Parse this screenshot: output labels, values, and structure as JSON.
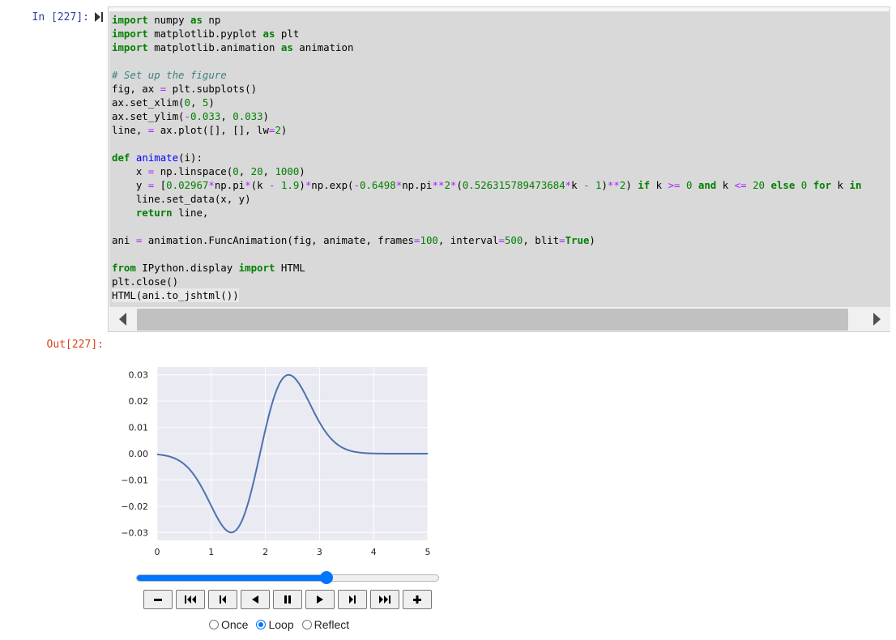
{
  "cell": {
    "in_prompt": "In [227]:",
    "out_prompt": "Out[227]:",
    "code_lines": [
      "import numpy as np",
      "import matplotlib.pyplot as plt",
      "import matplotlib.animation as animation",
      "",
      "# Set up the figure",
      "fig, ax = plt.subplots()",
      "ax.set_xlim(0, 5)",
      "ax.set_ylim(-0.033, 0.033)",
      "line, = ax.plot([], [], lw=2)",
      "",
      "def animate(i):",
      "    x = np.linspace(0, 20, 1000)",
      "    y = [0.02967*np.pi*(k - 1.9)*np.exp(-0.6498*np.pi**2*(0.526315789473684*k - 1)**2) if k >= 0 and k <= 20 else 0 for k in",
      "    line.set_data(x, y)",
      "    return line,",
      "",
      "ani = animation.FuncAnimation(fig, animate, frames=100, interval=500, blit=True)",
      "",
      "from IPython.display import HTML",
      "plt.close()",
      "HTML(ani.to_jshtml())"
    ]
  },
  "chart_data": {
    "type": "line",
    "xlim": [
      0,
      5
    ],
    "ylim": [
      -0.033,
      0.033
    ],
    "x_ticks": [
      "0",
      "1",
      "2",
      "3",
      "4",
      "5"
    ],
    "y_ticks": [
      "0.03",
      "0.02",
      "0.01",
      "0.00",
      "−0.01",
      "−0.02",
      "−0.03"
    ],
    "grid": true,
    "line_color": "#4c72b0",
    "background": "#eaeaf2",
    "function": {
      "a": 0.02967,
      "center": 1.9,
      "b": 0.6498,
      "scale": 0.526315789473684
    }
  },
  "player": {
    "progress": 0.63,
    "buttons": [
      {
        "name": "decrease-speed-button",
        "icon": "minus-icon",
        "glyph": "−"
      },
      {
        "name": "first-frame-button",
        "icon": "skip-first-icon",
        "glyph": "⏮"
      },
      {
        "name": "previous-frame-button",
        "icon": "step-back-icon",
        "glyph": "⏮"
      },
      {
        "name": "play-reverse-button",
        "icon": "play-reverse-icon",
        "glyph": "◀"
      },
      {
        "name": "pause-button",
        "icon": "pause-icon",
        "glyph": "⏸"
      },
      {
        "name": "play-button",
        "icon": "play-icon",
        "glyph": "▶"
      },
      {
        "name": "next-frame-button",
        "icon": "step-forward-icon",
        "glyph": "⏭"
      },
      {
        "name": "last-frame-button",
        "icon": "skip-last-icon",
        "glyph": "⏭"
      },
      {
        "name": "increase-speed-button",
        "icon": "plus-icon",
        "glyph": "+"
      }
    ],
    "loop_options": [
      {
        "label": "Once",
        "checked": false
      },
      {
        "label": "Loop",
        "checked": true
      },
      {
        "label": "Reflect",
        "checked": false
      }
    ]
  }
}
